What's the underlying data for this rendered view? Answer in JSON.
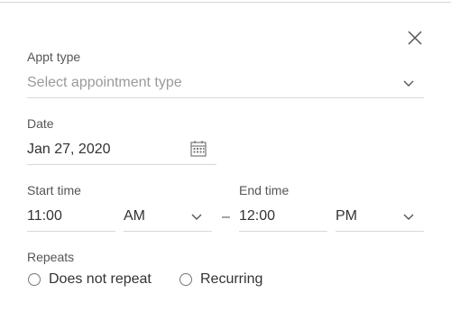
{
  "dialog": {
    "close_icon": "close-icon"
  },
  "appt_type": {
    "label": "Appt type",
    "placeholder": "Select appointment type",
    "value": ""
  },
  "date": {
    "label": "Date",
    "value": "Jan 27, 2020",
    "icon": "calendar-icon"
  },
  "start_time": {
    "label": "Start time",
    "time": "11:00",
    "ampm": "AM"
  },
  "separator": "–",
  "end_time": {
    "label": "End time",
    "time": "12:00",
    "ampm": "PM"
  },
  "repeats": {
    "label": "Repeats",
    "options": [
      "Does not repeat",
      "Recurring"
    ],
    "selected": null
  }
}
